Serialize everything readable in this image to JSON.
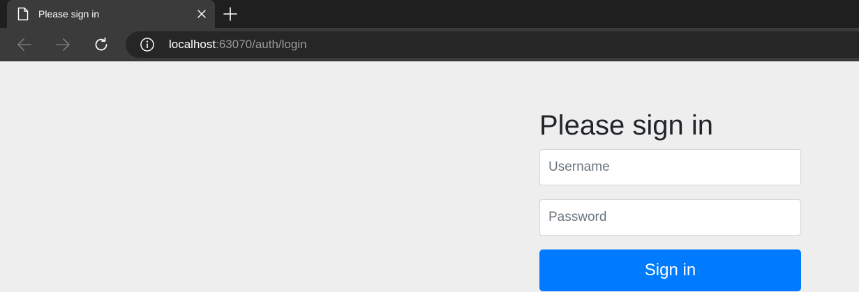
{
  "browser": {
    "tab": {
      "title": "Please sign in",
      "icon": "document-icon"
    },
    "new_tab_icon": "plus-icon",
    "toolbar": {
      "back_icon": "arrow-left-icon",
      "forward_icon": "arrow-right-icon",
      "reload_icon": "reload-icon",
      "site_info_icon": "info-icon"
    },
    "address": {
      "host": "localhost",
      "path": ":63070/auth/login"
    }
  },
  "login": {
    "heading": "Please sign in",
    "username_placeholder": "Username",
    "username_value": "",
    "password_placeholder": "Password",
    "password_value": "",
    "submit_label": "Sign in"
  },
  "colors": {
    "page_background": "#eeeeee",
    "primary_button": "#007bff",
    "tabbar": "#1f1f1f",
    "toolbar": "#3b3b3b"
  }
}
